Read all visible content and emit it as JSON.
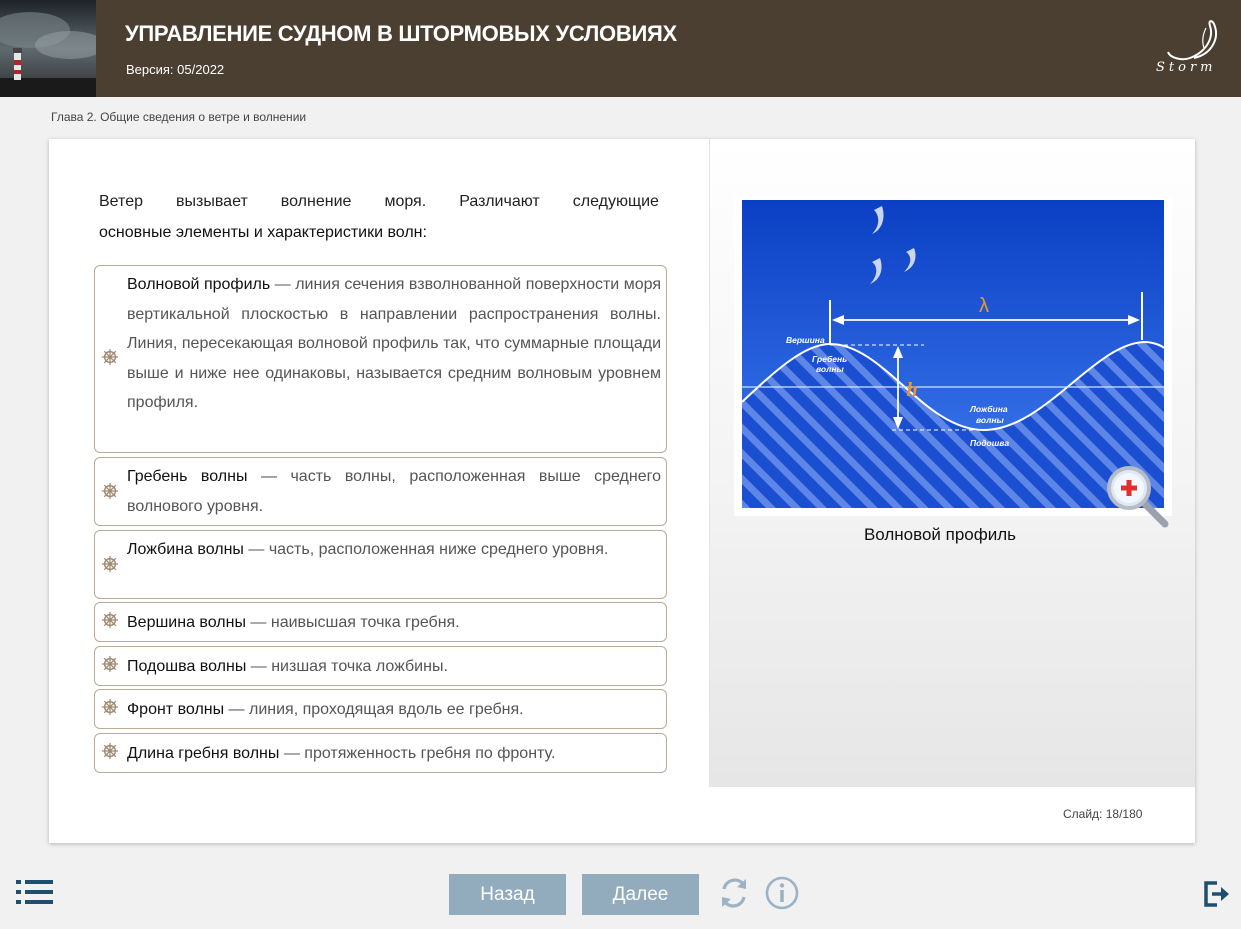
{
  "header": {
    "title": "УПРАВЛЕНИЕ СУДНОМ В ШТОРМОВЫХ УСЛОВИЯХ",
    "version": "Версия: 05/2022",
    "brand": "Storm"
  },
  "breadcrumb": "Глава 2. Общие сведения о ветре и волнении",
  "intro": {
    "line1_words": [
      "Ветер",
      "вызывает",
      "волнение",
      "моря.",
      "Различают",
      "следующие"
    ],
    "line2": "основные элементы и характеристики волн:"
  },
  "items": [
    {
      "term": "Волновой профиль",
      "dash": " — ",
      "text": "линия сечения взволнованной поверхности моря вертикальной плоскостью в направлении распространения волны. Линия, пересекающая волновой профиль так, что суммарные площади выше и ниже нее одинаковы, называется средним волновым уровнем профиля."
    },
    {
      "term": "Гребень волны",
      "dash": " — ",
      "text": "часть волны, расположенная выше среднего волнового уровня."
    },
    {
      "term": "Ложбина волны",
      "dash": " — ",
      "text": "часть, расположенная ниже среднего уровня."
    },
    {
      "term": "Вершина волны",
      "dash": " — ",
      "text": "наивысшая точка гребня."
    },
    {
      "term": "Подошва волны",
      "dash": " — ",
      "text": "низшая точка ложбины."
    },
    {
      "term": "Фронт волны",
      "dash": " — ",
      "text": "линия, проходящая вдоль ее гребня."
    },
    {
      "term": "Длина гребня волны",
      "dash": " — ",
      "text": "протяженность гребня по фронту."
    }
  ],
  "figure": {
    "caption": "Волновой профиль",
    "labels": {
      "lambda": "λ",
      "h": "h",
      "crest_top": "Вершина",
      "crest_line1": "Гребень",
      "crest_line2": "волны",
      "trough_line1": "Ложбина",
      "trough_line2": "волны",
      "trough_bottom": "Подошва"
    }
  },
  "slide": {
    "label": "Слайд:",
    "current": 18,
    "total": 180,
    "text": "18/180"
  },
  "nav": {
    "prev": "Назад",
    "next": "Далее"
  },
  "colors": {
    "header_bg": "#4b3f31",
    "button_bg": "#92acbd",
    "item_border": "#b9ab97",
    "accent_orange": "#e8891a"
  }
}
